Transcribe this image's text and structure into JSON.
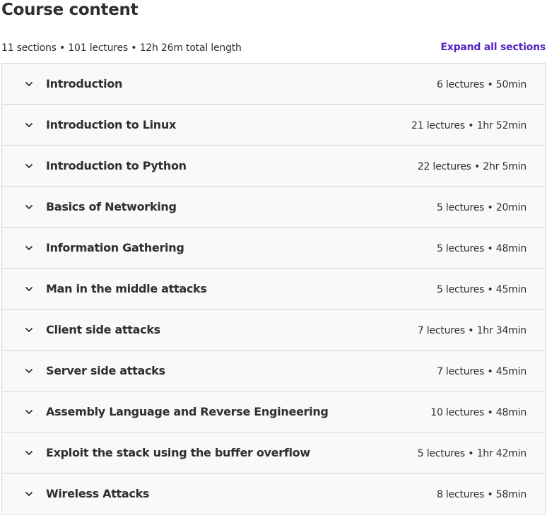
{
  "header": {
    "title": "Course content",
    "summary": "11 sections • 101 lectures • 12h 26m total length",
    "expand_all_label": "Expand all sections"
  },
  "colors": {
    "accent": "#5022c3",
    "row_background": "#f7f9fa",
    "border": "#d1d7dc",
    "text": "#2d2f31"
  },
  "sections": [
    {
      "title": "Introduction",
      "meta": "6 lectures • 50min",
      "icon": "chevron-down-icon"
    },
    {
      "title": "Introduction to Linux",
      "meta": "21 lectures • 1hr 52min",
      "icon": "chevron-down-icon"
    },
    {
      "title": "Introduction to Python",
      "meta": "22 lectures • 2hr 5min",
      "icon": "chevron-down-icon"
    },
    {
      "title": "Basics of Networking",
      "meta": "5 lectures • 20min",
      "icon": "chevron-down-icon"
    },
    {
      "title": "Information Gathering",
      "meta": "5 lectures • 48min",
      "icon": "chevron-down-icon"
    },
    {
      "title": "Man in the middle attacks",
      "meta": "5 lectures • 45min",
      "icon": "chevron-down-icon"
    },
    {
      "title": "Client side attacks",
      "meta": "7 lectures • 1hr 34min",
      "icon": "chevron-down-icon"
    },
    {
      "title": "Server side attacks",
      "meta": "7 lectures • 45min",
      "icon": "chevron-down-icon"
    },
    {
      "title": "Assembly Language and Reverse Engineering",
      "meta": "10 lectures • 48min",
      "icon": "chevron-down-icon"
    },
    {
      "title": "Exploit the stack using the buffer overflow",
      "meta": "5 lectures • 1hr 42min",
      "icon": "chevron-down-icon"
    },
    {
      "title": "Wireless Attacks",
      "meta": "8 lectures • 58min",
      "icon": "chevron-down-icon"
    }
  ]
}
